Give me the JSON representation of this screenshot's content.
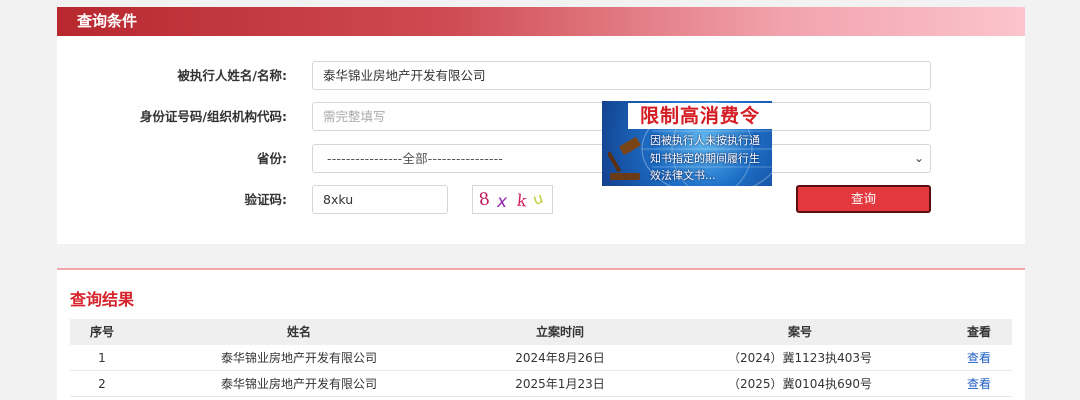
{
  "query_panel": {
    "title": "查询条件",
    "name_label": "被执行人姓名/名称:",
    "name_value": "泰华锦业房地产开发有限公司",
    "id_label": "身份证号码/组织机构代码:",
    "id_placeholder": "需完整填写",
    "province_label": "省份:",
    "province_value": "----------------全部----------------",
    "captcha_label": "验证码:",
    "captcha_value": "8xku",
    "captcha_image_text": "8xku",
    "query_button": "查询"
  },
  "banner": {
    "title": "限制高消费令",
    "line1": "因被执行人未按执行通",
    "line2": "知书指定的期间履行生",
    "line3": "效法律文书..."
  },
  "results": {
    "title": "查询结果",
    "columns": [
      "序号",
      "姓名",
      "立案时间",
      "案号",
      "查看"
    ],
    "rows": [
      {
        "index": "1",
        "name": "泰华锦业房地产开发有限公司",
        "date": "2024年8月26日",
        "case_no": "（2024）冀1123执403号",
        "view": "查看"
      },
      {
        "index": "2",
        "name": "泰华锦业房地产开发有限公司",
        "date": "2025年1月23日",
        "case_no": "（2025）冀0104执690号",
        "view": "查看"
      }
    ]
  },
  "colors": {
    "accent_red": "#e4383f",
    "header_gradient_start": "#b8282e",
    "link_blue": "#1f5fc4"
  }
}
